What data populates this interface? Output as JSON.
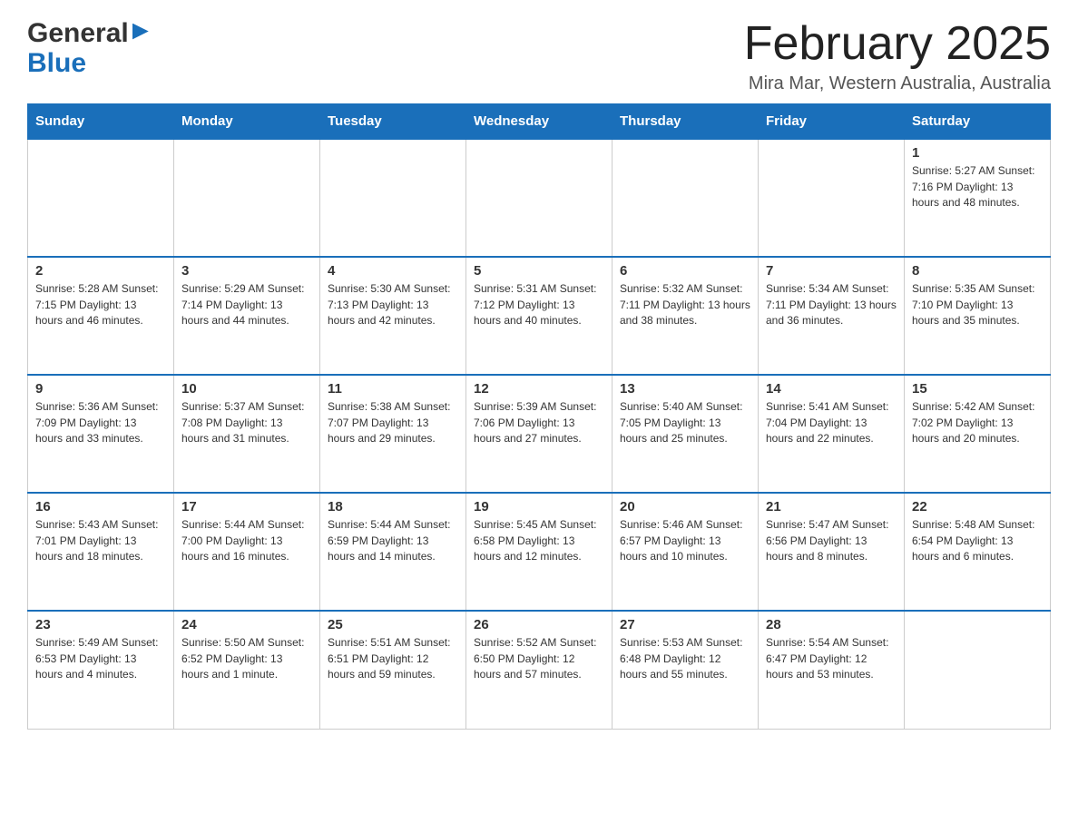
{
  "header": {
    "logo_general": "General",
    "logo_blue": "Blue",
    "month_title": "February 2025",
    "location": "Mira Mar, Western Australia, Australia"
  },
  "weekdays": [
    "Sunday",
    "Monday",
    "Tuesday",
    "Wednesday",
    "Thursday",
    "Friday",
    "Saturday"
  ],
  "weeks": [
    [
      {
        "day": "",
        "info": ""
      },
      {
        "day": "",
        "info": ""
      },
      {
        "day": "",
        "info": ""
      },
      {
        "day": "",
        "info": ""
      },
      {
        "day": "",
        "info": ""
      },
      {
        "day": "",
        "info": ""
      },
      {
        "day": "1",
        "info": "Sunrise: 5:27 AM\nSunset: 7:16 PM\nDaylight: 13 hours and 48 minutes."
      }
    ],
    [
      {
        "day": "2",
        "info": "Sunrise: 5:28 AM\nSunset: 7:15 PM\nDaylight: 13 hours and 46 minutes."
      },
      {
        "day": "3",
        "info": "Sunrise: 5:29 AM\nSunset: 7:14 PM\nDaylight: 13 hours and 44 minutes."
      },
      {
        "day": "4",
        "info": "Sunrise: 5:30 AM\nSunset: 7:13 PM\nDaylight: 13 hours and 42 minutes."
      },
      {
        "day": "5",
        "info": "Sunrise: 5:31 AM\nSunset: 7:12 PM\nDaylight: 13 hours and 40 minutes."
      },
      {
        "day": "6",
        "info": "Sunrise: 5:32 AM\nSunset: 7:11 PM\nDaylight: 13 hours and 38 minutes."
      },
      {
        "day": "7",
        "info": "Sunrise: 5:34 AM\nSunset: 7:11 PM\nDaylight: 13 hours and 36 minutes."
      },
      {
        "day": "8",
        "info": "Sunrise: 5:35 AM\nSunset: 7:10 PM\nDaylight: 13 hours and 35 minutes."
      }
    ],
    [
      {
        "day": "9",
        "info": "Sunrise: 5:36 AM\nSunset: 7:09 PM\nDaylight: 13 hours and 33 minutes."
      },
      {
        "day": "10",
        "info": "Sunrise: 5:37 AM\nSunset: 7:08 PM\nDaylight: 13 hours and 31 minutes."
      },
      {
        "day": "11",
        "info": "Sunrise: 5:38 AM\nSunset: 7:07 PM\nDaylight: 13 hours and 29 minutes."
      },
      {
        "day": "12",
        "info": "Sunrise: 5:39 AM\nSunset: 7:06 PM\nDaylight: 13 hours and 27 minutes."
      },
      {
        "day": "13",
        "info": "Sunrise: 5:40 AM\nSunset: 7:05 PM\nDaylight: 13 hours and 25 minutes."
      },
      {
        "day": "14",
        "info": "Sunrise: 5:41 AM\nSunset: 7:04 PM\nDaylight: 13 hours and 22 minutes."
      },
      {
        "day": "15",
        "info": "Sunrise: 5:42 AM\nSunset: 7:02 PM\nDaylight: 13 hours and 20 minutes."
      }
    ],
    [
      {
        "day": "16",
        "info": "Sunrise: 5:43 AM\nSunset: 7:01 PM\nDaylight: 13 hours and 18 minutes."
      },
      {
        "day": "17",
        "info": "Sunrise: 5:44 AM\nSunset: 7:00 PM\nDaylight: 13 hours and 16 minutes."
      },
      {
        "day": "18",
        "info": "Sunrise: 5:44 AM\nSunset: 6:59 PM\nDaylight: 13 hours and 14 minutes."
      },
      {
        "day": "19",
        "info": "Sunrise: 5:45 AM\nSunset: 6:58 PM\nDaylight: 13 hours and 12 minutes."
      },
      {
        "day": "20",
        "info": "Sunrise: 5:46 AM\nSunset: 6:57 PM\nDaylight: 13 hours and 10 minutes."
      },
      {
        "day": "21",
        "info": "Sunrise: 5:47 AM\nSunset: 6:56 PM\nDaylight: 13 hours and 8 minutes."
      },
      {
        "day": "22",
        "info": "Sunrise: 5:48 AM\nSunset: 6:54 PM\nDaylight: 13 hours and 6 minutes."
      }
    ],
    [
      {
        "day": "23",
        "info": "Sunrise: 5:49 AM\nSunset: 6:53 PM\nDaylight: 13 hours and 4 minutes."
      },
      {
        "day": "24",
        "info": "Sunrise: 5:50 AM\nSunset: 6:52 PM\nDaylight: 13 hours and 1 minute."
      },
      {
        "day": "25",
        "info": "Sunrise: 5:51 AM\nSunset: 6:51 PM\nDaylight: 12 hours and 59 minutes."
      },
      {
        "day": "26",
        "info": "Sunrise: 5:52 AM\nSunset: 6:50 PM\nDaylight: 12 hours and 57 minutes."
      },
      {
        "day": "27",
        "info": "Sunrise: 5:53 AM\nSunset: 6:48 PM\nDaylight: 12 hours and 55 minutes."
      },
      {
        "day": "28",
        "info": "Sunrise: 5:54 AM\nSunset: 6:47 PM\nDaylight: 12 hours and 53 minutes."
      },
      {
        "day": "",
        "info": ""
      }
    ]
  ]
}
